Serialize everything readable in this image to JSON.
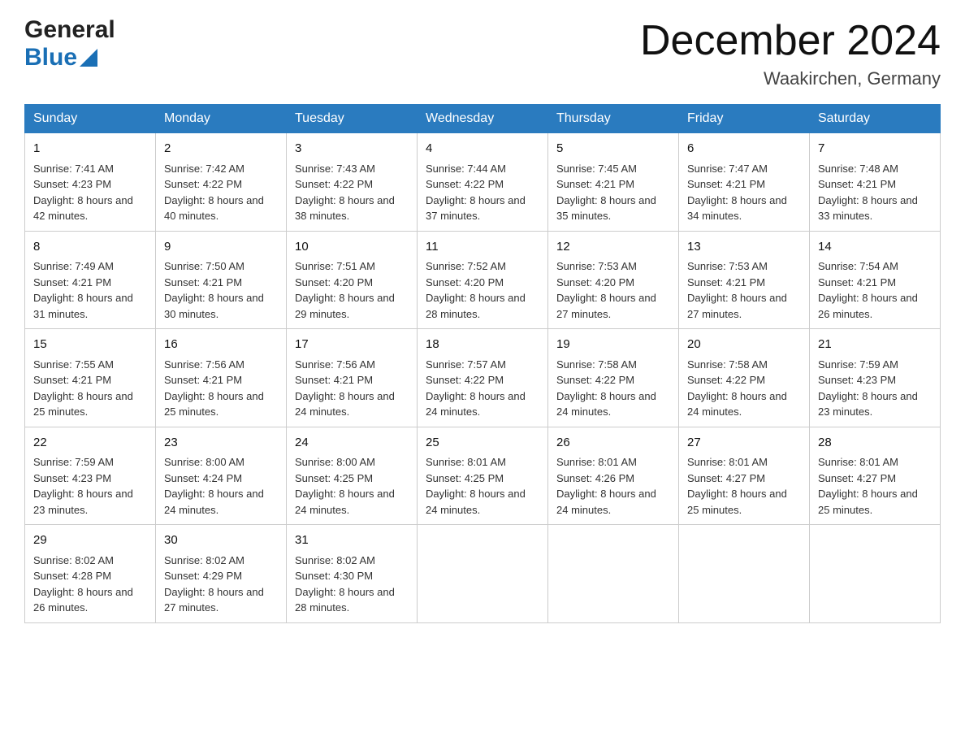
{
  "header": {
    "logo_general": "General",
    "logo_blue": "Blue",
    "month_title": "December 2024",
    "location": "Waakirchen, Germany"
  },
  "days_of_week": [
    "Sunday",
    "Monday",
    "Tuesday",
    "Wednesday",
    "Thursday",
    "Friday",
    "Saturday"
  ],
  "weeks": [
    [
      {
        "day": "1",
        "sunrise": "Sunrise: 7:41 AM",
        "sunset": "Sunset: 4:23 PM",
        "daylight": "Daylight: 8 hours and 42 minutes."
      },
      {
        "day": "2",
        "sunrise": "Sunrise: 7:42 AM",
        "sunset": "Sunset: 4:22 PM",
        "daylight": "Daylight: 8 hours and 40 minutes."
      },
      {
        "day": "3",
        "sunrise": "Sunrise: 7:43 AM",
        "sunset": "Sunset: 4:22 PM",
        "daylight": "Daylight: 8 hours and 38 minutes."
      },
      {
        "day": "4",
        "sunrise": "Sunrise: 7:44 AM",
        "sunset": "Sunset: 4:22 PM",
        "daylight": "Daylight: 8 hours and 37 minutes."
      },
      {
        "day": "5",
        "sunrise": "Sunrise: 7:45 AM",
        "sunset": "Sunset: 4:21 PM",
        "daylight": "Daylight: 8 hours and 35 minutes."
      },
      {
        "day": "6",
        "sunrise": "Sunrise: 7:47 AM",
        "sunset": "Sunset: 4:21 PM",
        "daylight": "Daylight: 8 hours and 34 minutes."
      },
      {
        "day": "7",
        "sunrise": "Sunrise: 7:48 AM",
        "sunset": "Sunset: 4:21 PM",
        "daylight": "Daylight: 8 hours and 33 minutes."
      }
    ],
    [
      {
        "day": "8",
        "sunrise": "Sunrise: 7:49 AM",
        "sunset": "Sunset: 4:21 PM",
        "daylight": "Daylight: 8 hours and 31 minutes."
      },
      {
        "day": "9",
        "sunrise": "Sunrise: 7:50 AM",
        "sunset": "Sunset: 4:21 PM",
        "daylight": "Daylight: 8 hours and 30 minutes."
      },
      {
        "day": "10",
        "sunrise": "Sunrise: 7:51 AM",
        "sunset": "Sunset: 4:20 PM",
        "daylight": "Daylight: 8 hours and 29 minutes."
      },
      {
        "day": "11",
        "sunrise": "Sunrise: 7:52 AM",
        "sunset": "Sunset: 4:20 PM",
        "daylight": "Daylight: 8 hours and 28 minutes."
      },
      {
        "day": "12",
        "sunrise": "Sunrise: 7:53 AM",
        "sunset": "Sunset: 4:20 PM",
        "daylight": "Daylight: 8 hours and 27 minutes."
      },
      {
        "day": "13",
        "sunrise": "Sunrise: 7:53 AM",
        "sunset": "Sunset: 4:21 PM",
        "daylight": "Daylight: 8 hours and 27 minutes."
      },
      {
        "day": "14",
        "sunrise": "Sunrise: 7:54 AM",
        "sunset": "Sunset: 4:21 PM",
        "daylight": "Daylight: 8 hours and 26 minutes."
      }
    ],
    [
      {
        "day": "15",
        "sunrise": "Sunrise: 7:55 AM",
        "sunset": "Sunset: 4:21 PM",
        "daylight": "Daylight: 8 hours and 25 minutes."
      },
      {
        "day": "16",
        "sunrise": "Sunrise: 7:56 AM",
        "sunset": "Sunset: 4:21 PM",
        "daylight": "Daylight: 8 hours and 25 minutes."
      },
      {
        "day": "17",
        "sunrise": "Sunrise: 7:56 AM",
        "sunset": "Sunset: 4:21 PM",
        "daylight": "Daylight: 8 hours and 24 minutes."
      },
      {
        "day": "18",
        "sunrise": "Sunrise: 7:57 AM",
        "sunset": "Sunset: 4:22 PM",
        "daylight": "Daylight: 8 hours and 24 minutes."
      },
      {
        "day": "19",
        "sunrise": "Sunrise: 7:58 AM",
        "sunset": "Sunset: 4:22 PM",
        "daylight": "Daylight: 8 hours and 24 minutes."
      },
      {
        "day": "20",
        "sunrise": "Sunrise: 7:58 AM",
        "sunset": "Sunset: 4:22 PM",
        "daylight": "Daylight: 8 hours and 24 minutes."
      },
      {
        "day": "21",
        "sunrise": "Sunrise: 7:59 AM",
        "sunset": "Sunset: 4:23 PM",
        "daylight": "Daylight: 8 hours and 23 minutes."
      }
    ],
    [
      {
        "day": "22",
        "sunrise": "Sunrise: 7:59 AM",
        "sunset": "Sunset: 4:23 PM",
        "daylight": "Daylight: 8 hours and 23 minutes."
      },
      {
        "day": "23",
        "sunrise": "Sunrise: 8:00 AM",
        "sunset": "Sunset: 4:24 PM",
        "daylight": "Daylight: 8 hours and 24 minutes."
      },
      {
        "day": "24",
        "sunrise": "Sunrise: 8:00 AM",
        "sunset": "Sunset: 4:25 PM",
        "daylight": "Daylight: 8 hours and 24 minutes."
      },
      {
        "day": "25",
        "sunrise": "Sunrise: 8:01 AM",
        "sunset": "Sunset: 4:25 PM",
        "daylight": "Daylight: 8 hours and 24 minutes."
      },
      {
        "day": "26",
        "sunrise": "Sunrise: 8:01 AM",
        "sunset": "Sunset: 4:26 PM",
        "daylight": "Daylight: 8 hours and 24 minutes."
      },
      {
        "day": "27",
        "sunrise": "Sunrise: 8:01 AM",
        "sunset": "Sunset: 4:27 PM",
        "daylight": "Daylight: 8 hours and 25 minutes."
      },
      {
        "day": "28",
        "sunrise": "Sunrise: 8:01 AM",
        "sunset": "Sunset: 4:27 PM",
        "daylight": "Daylight: 8 hours and 25 minutes."
      }
    ],
    [
      {
        "day": "29",
        "sunrise": "Sunrise: 8:02 AM",
        "sunset": "Sunset: 4:28 PM",
        "daylight": "Daylight: 8 hours and 26 minutes."
      },
      {
        "day": "30",
        "sunrise": "Sunrise: 8:02 AM",
        "sunset": "Sunset: 4:29 PM",
        "daylight": "Daylight: 8 hours and 27 minutes."
      },
      {
        "day": "31",
        "sunrise": "Sunrise: 8:02 AM",
        "sunset": "Sunset: 4:30 PM",
        "daylight": "Daylight: 8 hours and 28 minutes."
      },
      null,
      null,
      null,
      null
    ]
  ]
}
